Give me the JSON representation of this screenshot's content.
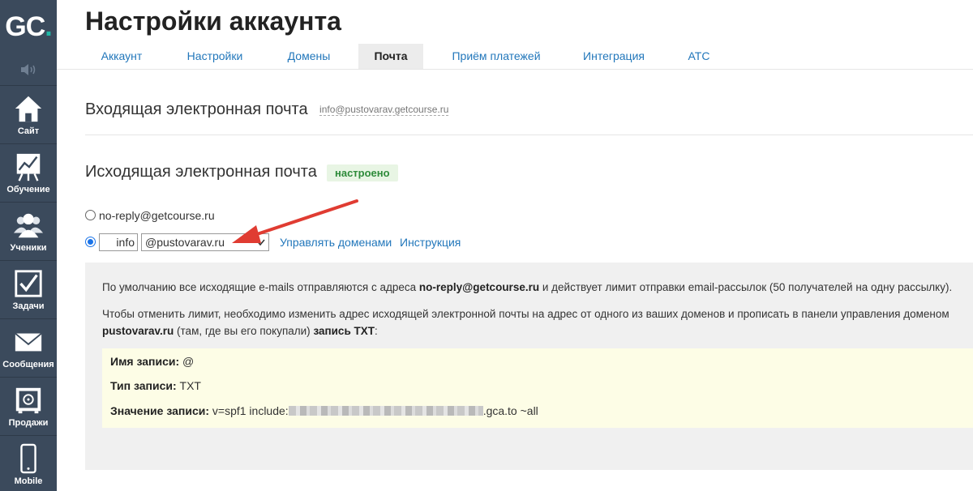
{
  "sidebar": {
    "logo": {
      "text": "GC",
      "dot": "."
    },
    "items": [
      {
        "label": "Сайт",
        "icon": "house-icon"
      },
      {
        "label": "Обучение",
        "icon": "chart-board-icon"
      },
      {
        "label": "Ученики",
        "icon": "users-icon"
      },
      {
        "label": "Задачи",
        "icon": "checkbox-icon"
      },
      {
        "label": "Сообщения",
        "icon": "envelope-icon"
      },
      {
        "label": "Продажи",
        "icon": "safe-icon"
      },
      {
        "label": "Mobile",
        "icon": "phone-icon"
      }
    ]
  },
  "page": {
    "title": "Настройки аккаунта"
  },
  "tabs": [
    {
      "label": "Аккаунт",
      "active": false
    },
    {
      "label": "Настройки",
      "active": false
    },
    {
      "label": "Домены",
      "active": false
    },
    {
      "label": "Почта",
      "active": true
    },
    {
      "label": "Приём платежей",
      "active": false
    },
    {
      "label": "Интеграция",
      "active": false
    },
    {
      "label": "АТС",
      "active": false
    }
  ],
  "incoming": {
    "heading": "Входящая электронная почта",
    "email": "info@pustovarav.getcourse.ru"
  },
  "outgoing": {
    "heading": "Исходящая электронная почта",
    "status": "настроено",
    "option_default": "no-reply@getcourse.ru",
    "local_part": "info",
    "domain_selected": "@pustovarav.ru",
    "link_manage": "Управлять доменами",
    "link_instruction": "Инструкция"
  },
  "info": {
    "p1_a": "По умолчанию все исходящие e-mails отправляются с адреса ",
    "p1_b": "no-reply@getcourse.ru",
    "p1_c": " и действует лимит отправки email-рассылок (50 получателей на одну рассылку).",
    "p2_a": "Чтобы отменить лимит, необходимо изменить адрес исходящей электронной почты на адрес от одного из ваших доменов   и прописать в панели управления доменом",
    "p2_b": "pustovarav.ru",
    "p2_c": " (там, где вы его покупали) ",
    "p2_d": "запись TXT",
    "p2_e": ":",
    "record": {
      "name_label": "Имя записи:",
      "name_value": "@",
      "type_label": "Тип записи:",
      "type_value": "TXT",
      "value_label": "Значение записи:",
      "value_prefix": "v=spf1 include:",
      "value_suffix": ".gca.to ~all"
    }
  },
  "colors": {
    "sidebar": "#3b4a5c",
    "accent": "#1fb8a6",
    "link": "#2277bb",
    "badge_bg": "#e8f5e4",
    "badge_text": "#2e8b3a",
    "arrow": "#e03c32"
  }
}
